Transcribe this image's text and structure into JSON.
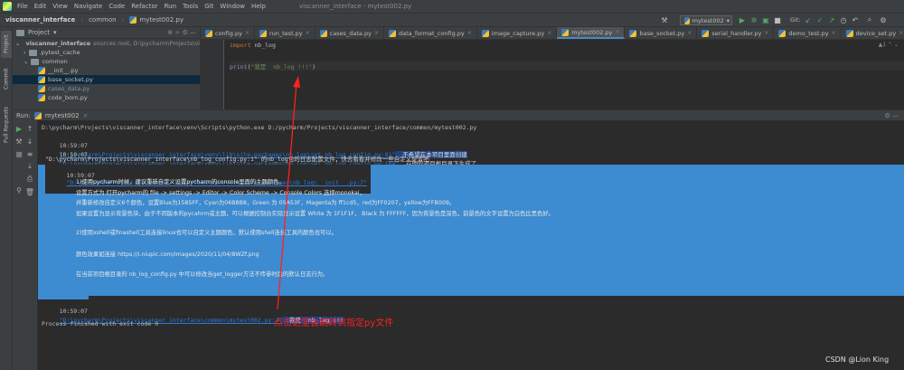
{
  "menu": [
    "File",
    "Edit",
    "View",
    "Navigate",
    "Code",
    "Refactor",
    "Run",
    "Tools",
    "Git",
    "Window",
    "Help"
  ],
  "window_title": "viscanner_interface - mytest002.py",
  "breadcrumb": [
    "viscanner_interface",
    "common",
    "mytest002.py"
  ],
  "run_config": "mytest002",
  "git_label": "Git:",
  "project": {
    "header": "Project",
    "rows": [
      {
        "label": "viscanner_interface",
        "extra": "sources root, D:\\pycharm\\Projects\\viscanner_interface"
      },
      {
        "label": ".pytest_cache",
        "extra": ""
      },
      {
        "label": "common",
        "extra": ""
      },
      {
        "label": "__init__.py",
        "extra": ""
      },
      {
        "label": "base_socket.py",
        "extra": ""
      },
      {
        "label": "cases_data.py",
        "extra": ""
      },
      {
        "label": "code_born.py",
        "extra": ""
      }
    ]
  },
  "left_stripe": [
    "Project",
    "Commit",
    "Pull Requests"
  ],
  "tabs": [
    "config.py",
    "run_test.py",
    "cases_data.py",
    "data_format_config.py",
    "image_capture.py",
    "mytest002.py",
    "base_socket.py",
    "serial_handler.py",
    "demo_test.py",
    "device_set.py"
  ],
  "editor": {
    "line1_kw": "import",
    "line1_rest": " nb_log",
    "line4_fn": "print",
    "line4_open": "(",
    "line4_str": "\"我是  nb_log !!!\"",
    "line4_close": ")"
  },
  "run": {
    "header": "Run:",
    "tab": "mytest002",
    "cmd": "D:\\pycharm\\Projects\\viscanner_interface\\venv\\Scripts\\python.exe D:/pycharm/Projects/viscanner_interface/common/mytest002.py",
    "l1_time": "10:59:07",
    "l1_link": "\"D:\\pycharm\\Projects\\viscanner_interface\\venv\\lib\\site-packages\\nb_log\\set_nb_log_config.py:81\"",
    "l1_msg": "  不希望在本项目里面创建",
    "l2_time": "10:59:07",
    "l2_link": "\"D:\\pycharm\\Projects\\viscanner_interface\\venv\\lib\\site-packages\\nb_log\\set_nb_log_config.py:104\"",
    "l2_msg": "  在你的项目根目录下生成了",
    "l3": "\"D:\\pycharm\\Projects\\viscanner_interface\\nb_log_config.py:1\" 的nb_log包的日志配置文件，快去看看并修改一些自定义配置吧",
    "l4_time": "10:59:07",
    "l4_link": "\"D:\\pycharm\\Projects\\viscanner_interface\\venv\\lib\\site-packages\\nb_log\\__init__.py:7\"",
    "sel": [
      "1)使用pycharm时候，建议重新自定义设置pycharm的console里面的主题颜色。",
      "设置方式为 打开pycharm的 file -> settings -> Editor -> Color Scheme -> Console Colors 选择monokai，",
      "并重新修改自定义6个颜色，设置Blue为1585FF，Cyan为06B8B8，Green 为 05A53F，Magenta为 ff1cd5，red为FF0207，yellow为FFB009。",
      "如果设置为显示背景色块，由于不同版本的pycahrm或主题，可以根据控制台实际显示设置 White 为 1F1F1F， Black 为 FFFFFF，因为背景色是深色，前景色的文字设置为白色比黑色好。",
      "2)使用xshell或finashell工具连接linux也可以自定义主题颜色，默认使用shell连接工具的颜色也可以。",
      "颜色效果如连接 https://i.niupic.com/images/2020/11/04/8WZf.png",
      "在当前项目根目录的 nb_log_config.py 中可以修改当get_logger方法不传参时后的默认日志行为。"
    ],
    "l5_time": "10:59:07",
    "l5_link": "\"D:\\pycharm\\Projects\\viscanner_interface\\common\\mytest002.py:3\"",
    "l5_msg": "  我是  nb_log !!!",
    "exit": "Process finished with exit code 0"
  },
  "annotation": "点击这里会跳转到指定py文件",
  "watermark": "CSDN @Lion King",
  "colors": {
    "accent": "#3d8bd0",
    "link": "#287bde",
    "annotation": "#ff2020"
  }
}
